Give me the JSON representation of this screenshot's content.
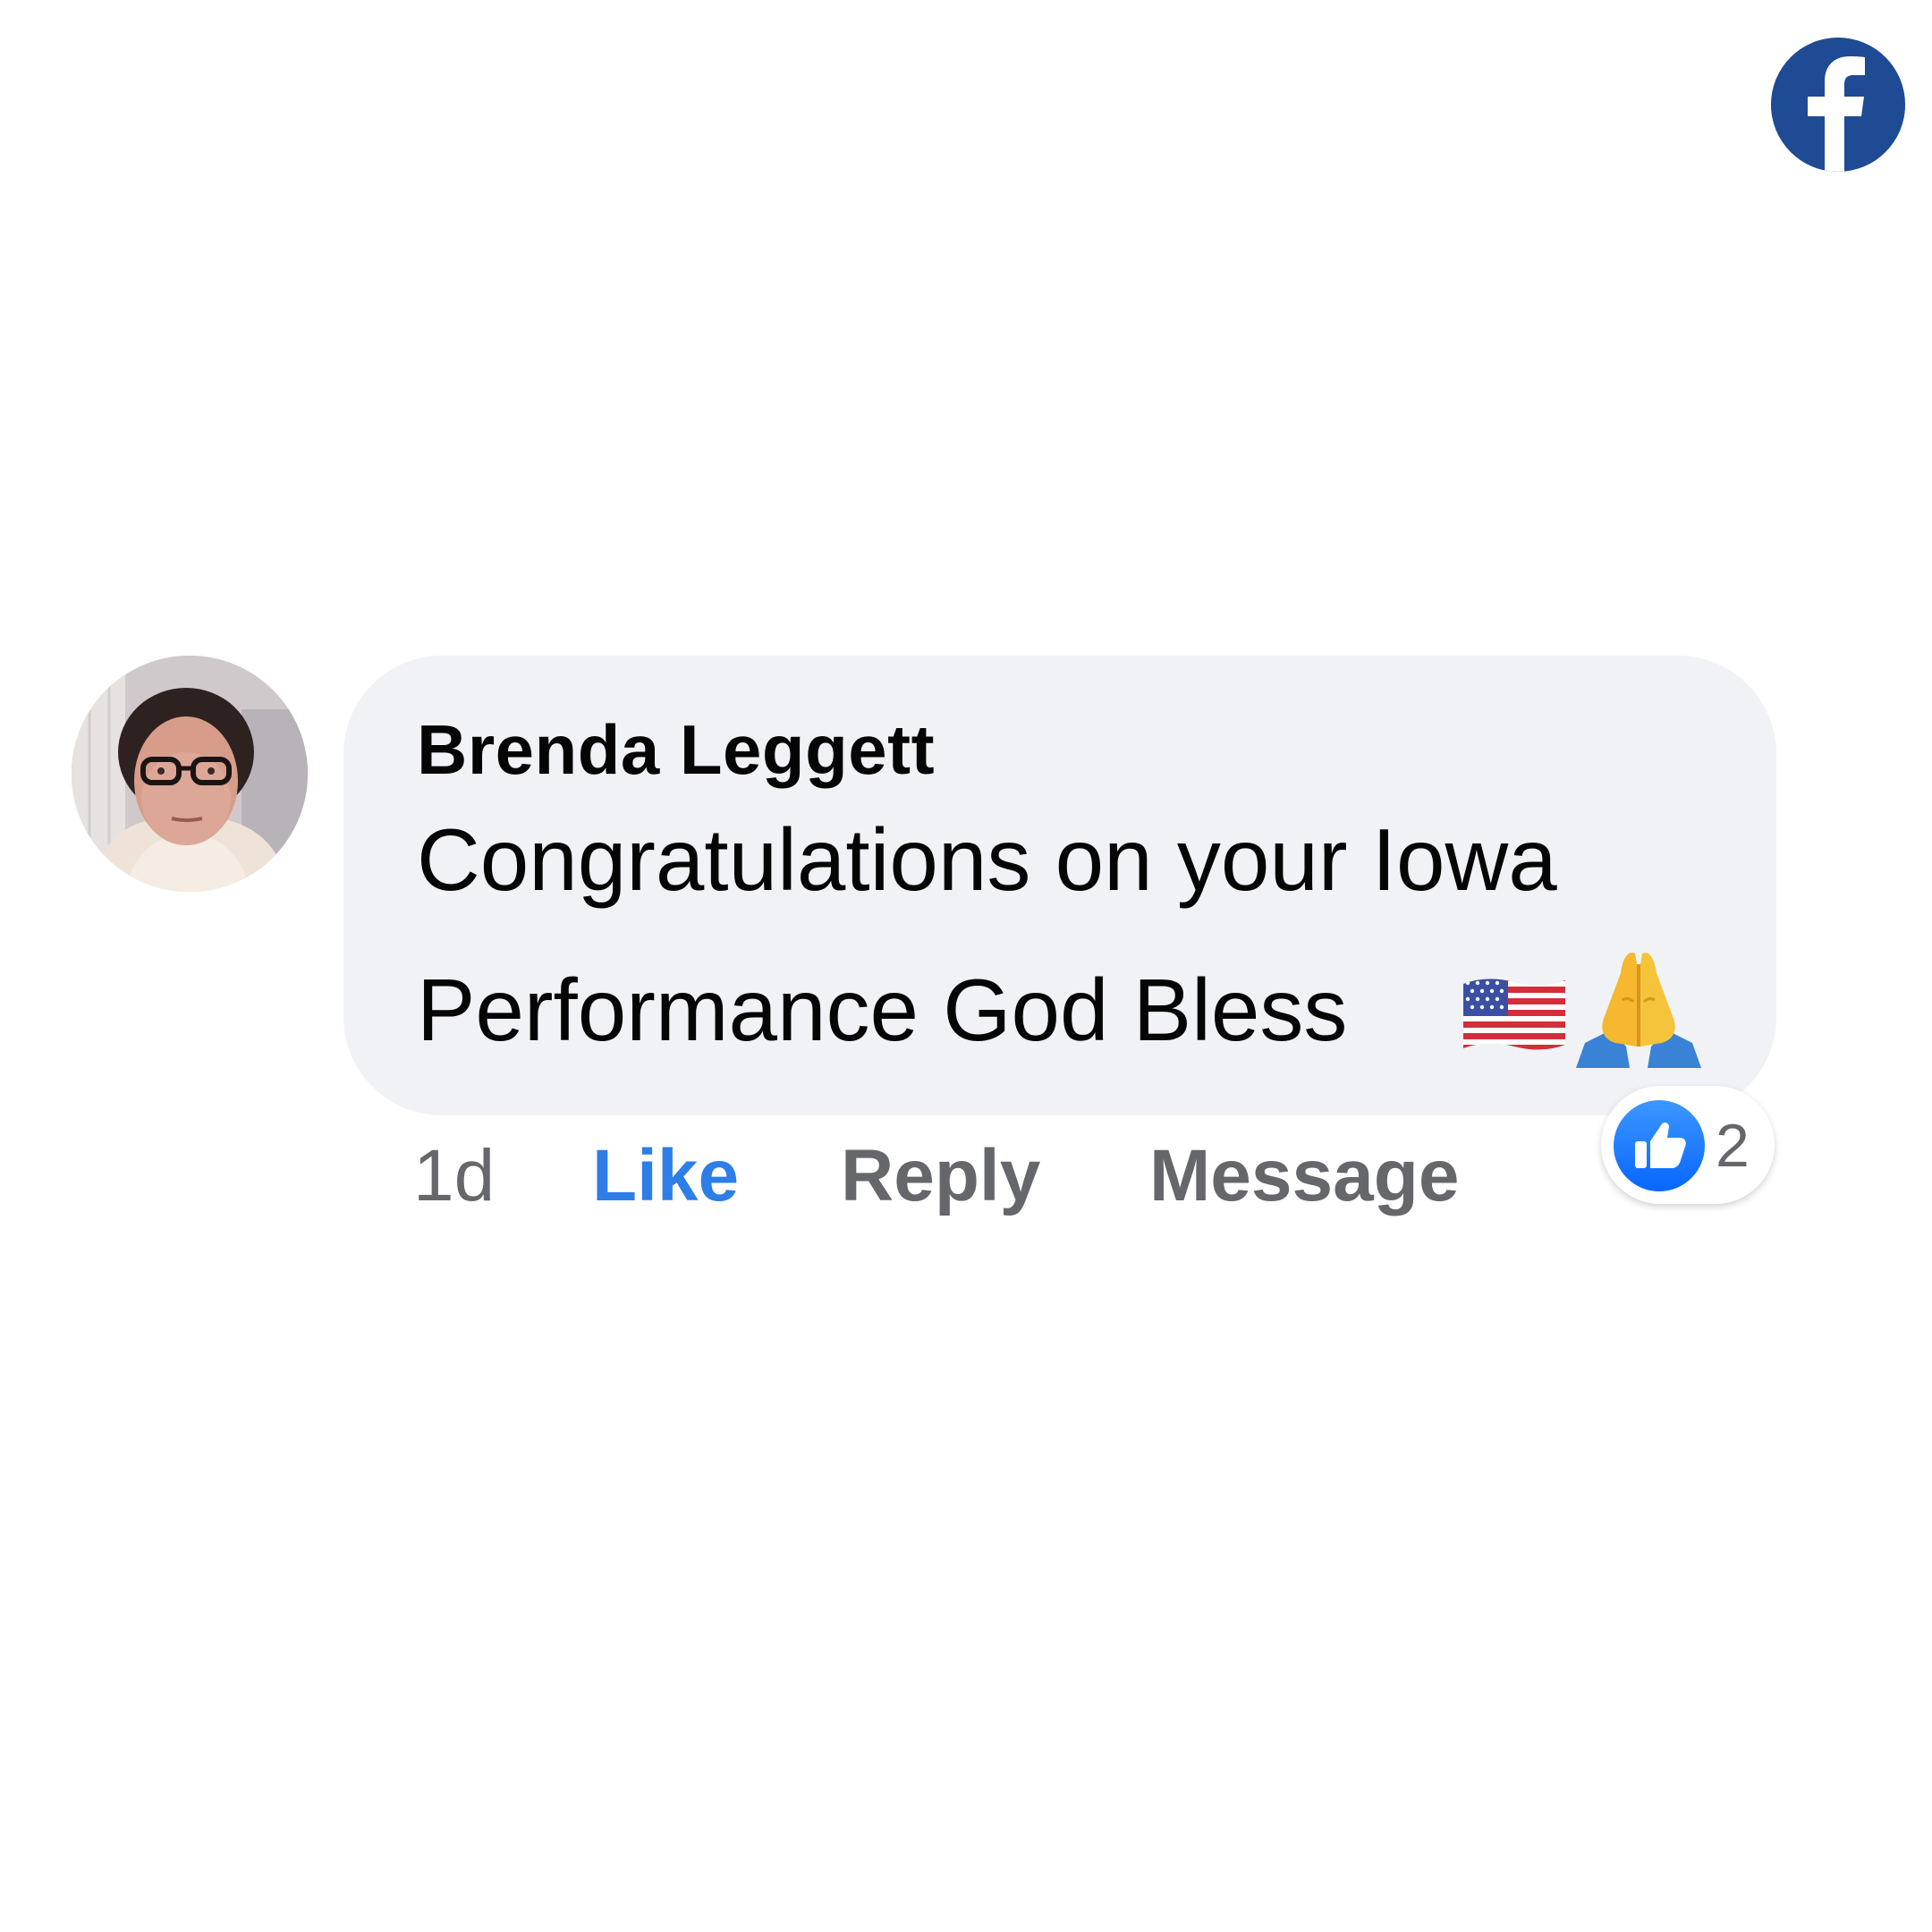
{
  "brand": {
    "logo_icon": "facebook-f-icon",
    "color": "#1f4b95"
  },
  "comment": {
    "avatar_icon": "profile-photo",
    "author": "Brenda Leggett",
    "text_line1": "Congratulations on your Iowa",
    "text_line2": "Performance God Bless",
    "emojis": [
      "us-flag-emoji",
      "folded-hands-emoji"
    ],
    "bubble_color": "#f0f2f5"
  },
  "actions": {
    "time": "1d",
    "like_label": "Like",
    "reply_label": "Reply",
    "message_label": "Message",
    "like_color": "#2d7ee7",
    "muted_color": "#65676b"
  },
  "reactions": {
    "icon": "like-thumbs-up-icon",
    "count": "2",
    "icon_color": "#2d7ee7"
  }
}
